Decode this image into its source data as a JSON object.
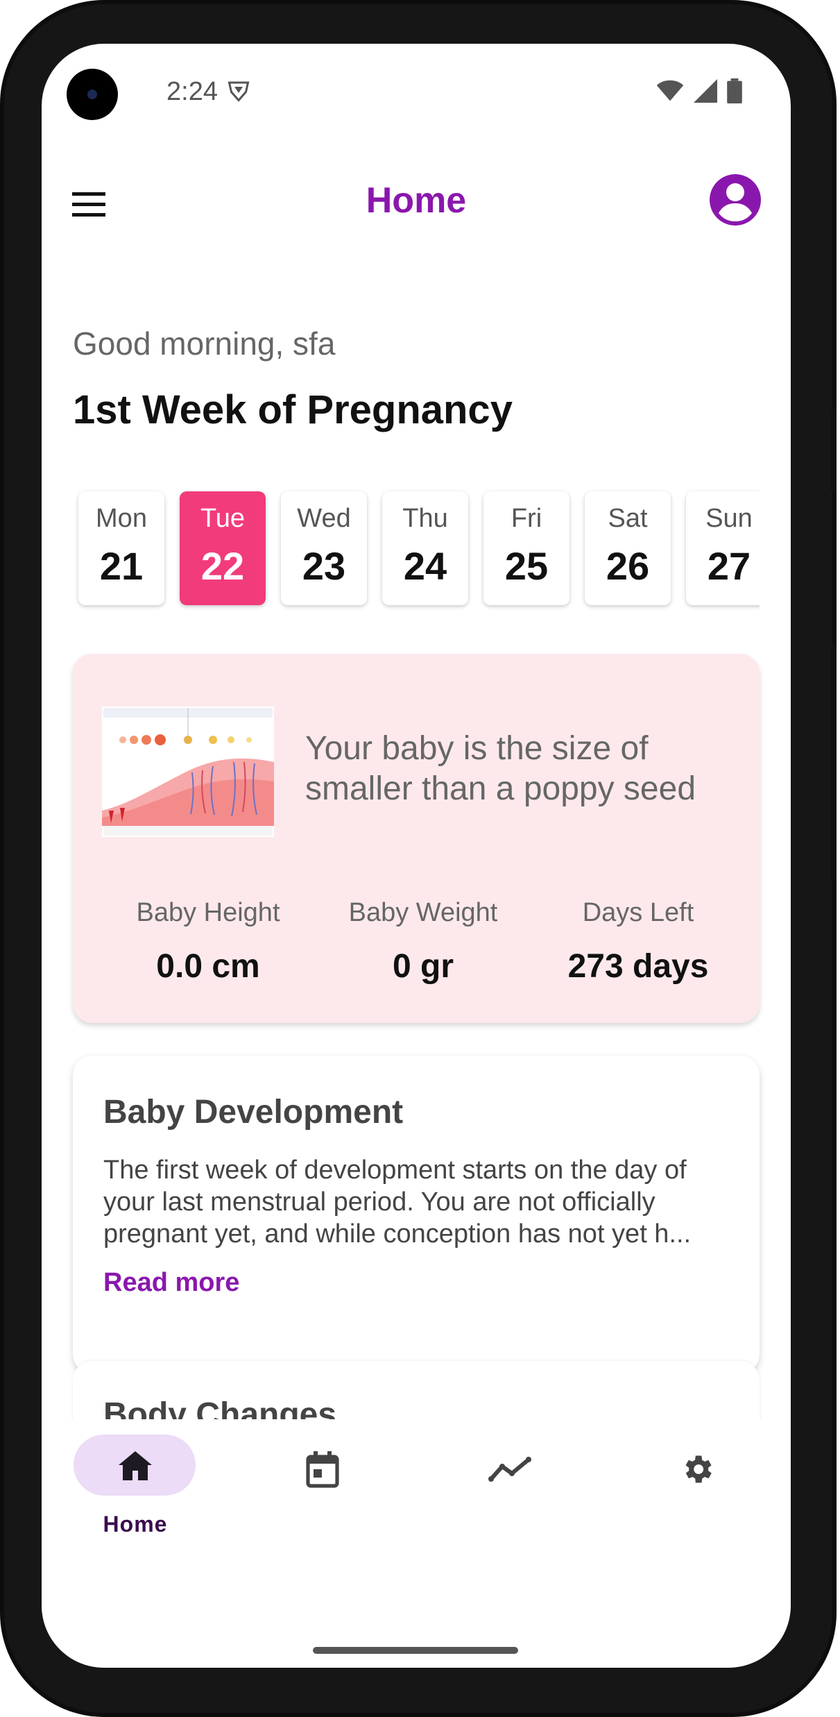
{
  "status_bar": {
    "time": "2:24"
  },
  "app_bar": {
    "title": "Home"
  },
  "greeting": "Good morning, sfa",
  "week_title": "1st Week of Pregnancy",
  "days": [
    {
      "name": "Mon",
      "num": "21"
    },
    {
      "name": "Tue",
      "num": "22"
    },
    {
      "name": "Wed",
      "num": "23"
    },
    {
      "name": "Thu",
      "num": "24"
    },
    {
      "name": "Fri",
      "num": "25"
    },
    {
      "name": "Sat",
      "num": "26"
    },
    {
      "name": "Sun",
      "num": "27"
    }
  ],
  "selected_day_index": 1,
  "size_card": {
    "size_text": "Your baby is the size of smaller than a poppy seed",
    "stats": [
      {
        "label": "Baby Height",
        "value": "0.0 cm"
      },
      {
        "label": "Baby Weight",
        "value": "0 gr"
      },
      {
        "label": "Days Left",
        "value": "273 days"
      }
    ]
  },
  "development": {
    "title": "Baby Development",
    "body": "The first week of development starts on the day of your last menstrual period. You are not officially pregnant yet, and while conception has not yet h...",
    "read_more": "Read more"
  },
  "body_changes": {
    "title": "Body Changes"
  },
  "bottom_nav": {
    "items": [
      {
        "label": "Home",
        "icon": "home-icon",
        "active": true
      },
      {
        "label": "",
        "icon": "calendar-icon",
        "active": false
      },
      {
        "label": "",
        "icon": "trend-icon",
        "active": false
      },
      {
        "label": "",
        "icon": "gear-icon",
        "active": false
      }
    ]
  },
  "colors": {
    "accent": "#8a17ad",
    "selected_day": "#f23b7b",
    "size_card_bg": "#fde9ec",
    "nav_pill": "#ecdcf7"
  }
}
